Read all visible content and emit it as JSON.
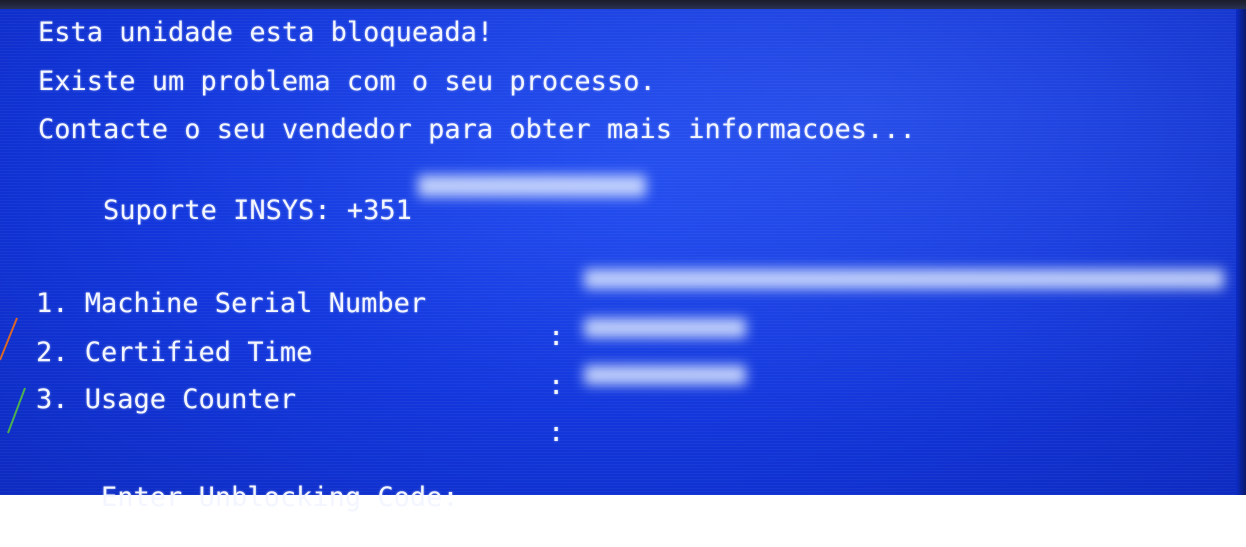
{
  "message": {
    "line1": "Esta unidade esta bloqueada!",
    "line2": "Existe um problema com o seu processo.",
    "line3": "Contacte o seu vendedor para obter mais informacoes...",
    "support_label": "Suporte INSYS: +351"
  },
  "fields": [
    {
      "label": "1. Machine Serial Number",
      "separator": ":"
    },
    {
      "label": "2. Certified Time",
      "separator": ":"
    },
    {
      "label": "3. Usage Counter",
      "separator": ":"
    }
  ],
  "prompt": {
    "label": "Enter Unblocking Code:",
    "value": ""
  },
  "colors": {
    "screen_background": "#1236db",
    "text": "#f3f6ff"
  }
}
